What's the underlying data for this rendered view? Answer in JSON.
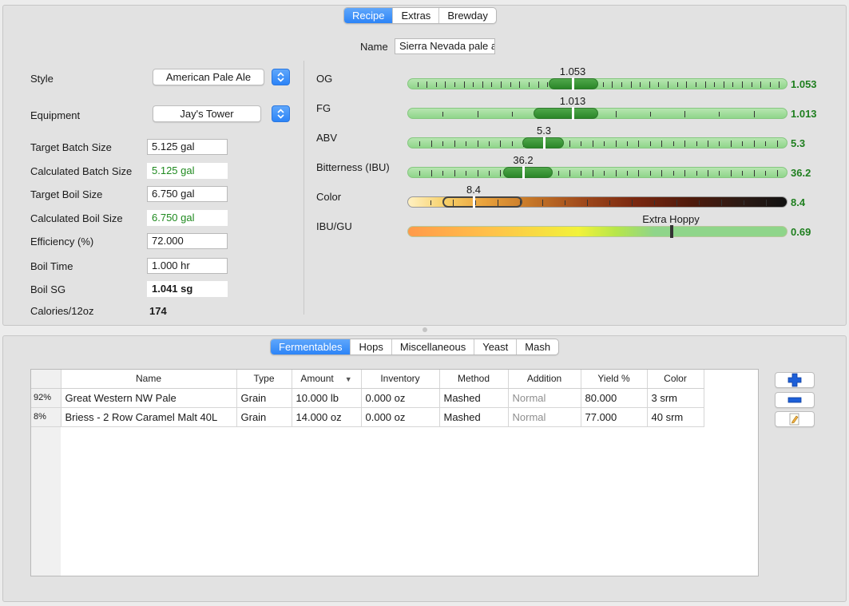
{
  "recipe_tabs": [
    "Recipe",
    "Extras",
    "Brewday"
  ],
  "name": {
    "label": "Name",
    "value": "Sierra Nevada pale a"
  },
  "style": {
    "label": "Style",
    "value": "American Pale Ale"
  },
  "equipment": {
    "label": "Equipment",
    "value": "Jay's Tower"
  },
  "fields": [
    {
      "label": "Target Batch Size",
      "value": "5.125 gal"
    },
    {
      "label": "Calculated Batch Size",
      "value": "5.125 gal"
    },
    {
      "label": "Target Boil Size",
      "value": "6.750 gal"
    },
    {
      "label": "Calculated Boil Size",
      "value": "6.750 gal"
    },
    {
      "label": "Efficiency (%)",
      "value": "72.000"
    },
    {
      "label": "Boil Time",
      "value": "1.000 hr"
    },
    {
      "label": "Boil SG",
      "value": "1.041 sg"
    },
    {
      "label": "Calories/12oz",
      "value": "174"
    }
  ],
  "meters": [
    {
      "label": "OG",
      "marker_text": "1.053",
      "right_text": "1.053",
      "marker": 0.43,
      "band": [
        0.37,
        0.5
      ],
      "ticks": 40
    },
    {
      "label": "FG",
      "marker_text": "1.013",
      "right_text": "1.013",
      "marker": 0.43,
      "band": [
        0.33,
        0.5
      ],
      "ticks": 10
    },
    {
      "label": "ABV",
      "marker_text": "5.3",
      "right_text": "5.3",
      "marker": 0.355,
      "band": [
        0.3,
        0.41
      ],
      "ticks": 32
    },
    {
      "label": "Bitterness (IBU)",
      "marker_text": "36.2",
      "right_text": "36.2",
      "marker": 0.3,
      "band": [
        0.25,
        0.38
      ],
      "ticks": 32
    },
    {
      "label": "Color",
      "marker_text": "8.4",
      "right_text": "8.4",
      "marker": 0.17,
      "band": [
        0.09,
        0.3
      ],
      "ticks": 16
    },
    {
      "label": "IBU/GU",
      "marker_text": "Extra Hoppy",
      "right_text": "0.69",
      "marker": 0.69,
      "band": null,
      "ticks": 0
    }
  ],
  "ingredient_tabs": [
    "Fermentables",
    "Hops",
    "Miscellaneous",
    "Yeast",
    "Mash"
  ],
  "table": {
    "headers": [
      "",
      "Name",
      "Type",
      "Amount",
      "Inventory",
      "Method",
      "Addition",
      "Yield %",
      "Color"
    ],
    "rows": [
      [
        "92%",
        "Great Western NW Pale",
        "Grain",
        "10.000 lb",
        "0.000 oz",
        "Mashed",
        "Normal",
        "80.000",
        "3 srm"
      ],
      [
        "8%",
        "Briess - 2 Row Caramel Malt 40L",
        "Grain",
        "14.000 oz",
        "0.000 oz",
        "Mashed",
        "Normal",
        "77.000",
        "40 srm"
      ]
    ]
  },
  "colors": {
    "accent": "#2c84f7",
    "green_value": "#1f7f1f"
  }
}
